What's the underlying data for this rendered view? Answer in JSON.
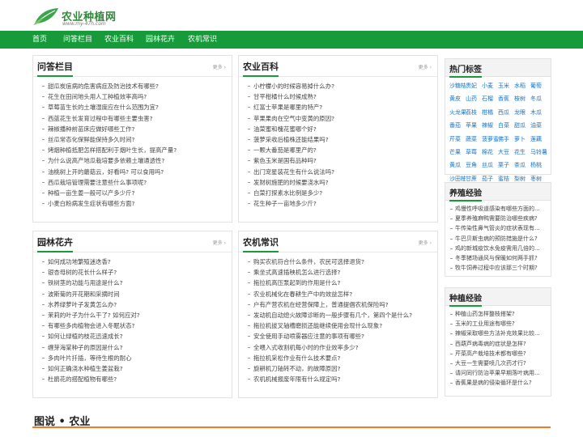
{
  "site": {
    "title": "农业种植网",
    "subtitle": "www.my-47h.com"
  },
  "nav": [
    "首页",
    "问答栏目",
    "农业百科",
    "园林花卉",
    "农机常识"
  ],
  "panels": {
    "qa": {
      "title": "问答栏目",
      "more": "更多",
      "items": [
        "甜瓜炭疽病的危害病症及防治技术有哪些?",
        "花生在田间地头用人工种植效率高吗?",
        "草莓苗生长的土壤湿度应在什么范围为宜?",
        "西蓝花生长发育过程中有哪些主要虫害?",
        "辣椒播种前苗床应做好哪些工作?",
        "丝瓜常态化保鲜能保持多久时间?",
        "烤烟种植抵肥怎样搭配利于烟叶生长，提高产量?",
        "为什么说高产地瓜栽培要多依赖土壤通透性?",
        "油桃树上开的蘑菇云，好看吗? 可以食用吗?",
        "西瓜栽培管理需要注意些什么事项呢?",
        "种植一亩生姜一般可以产多少斤?",
        "小麦白粉病发生症状有哪些方面?"
      ]
    },
    "encyclopedia": {
      "title": "农业百科",
      "more": "更多",
      "items": [
        "小柠檬小的时候容易掉什么办?",
        "甘平柑橘什么时候成熟?",
        "红富士苹果是哪里的特产?",
        "苹果果肉在空气中变黄的原因?",
        "油菜蜜和槐花蜜哪个好?",
        "菠萝采收后植株还能结果吗?",
        "一颗大番茄是哪里产的?",
        "紫色玉米是国有品种吗?",
        "出门宠星装花生有什么说法吗?",
        "发财树施肥的时候要浇水吗?",
        "白菜打探素水比例是多少?",
        "花生种子一亩地多少斤?"
      ]
    },
    "garden": {
      "title": "园林花卉",
      "more": "更多",
      "items": [
        "如何成功地繁殖迷迭香?",
        "银杏母树的花长什么样子?",
        "铁树茎的功能与用途是什么?",
        "波斯菊的开花期和采摘时间",
        "水养绿萝叶子发黄怎么办?",
        "茉莉的叶子为什么干了? 如何应对?",
        "有哪些多肉植物会进入冬眠状态?",
        "如何让绿植的枝花迅速成长?",
        "缠芽海棠种子的原因是什么?",
        "多肉叶片扦插，等待生根的耐心",
        "如何正确浇水种植生姜盆栽?",
        "杜鹃花的搭配植物有哪些?"
      ]
    },
    "machinery": {
      "title": "农机常识",
      "more": "更多",
      "items": [
        "购买农机符合什么条件，农民可选择退货?",
        "乘坐式高速插秧机怎么进行选择?",
        "拖拉机高压泵起到的作用是什么?",
        "农业机械化在春耕生产中的效益怎样?",
        "户有产营农机在经营保障上，普通提倡农机保险吗?",
        "发动机自动熄火故障诊断的一般步骤有几个，第四个是什么?",
        "拖拉机拔叉轴槽磨损还能继续使用会现什么现象?",
        "安全使用手动喷雾器应注意的事项有哪些?",
        "全喂入式收割机每小时的作业效率多少?",
        "拖拉机采松作业有什么技术要点?",
        "旋耕机刀轴转不动，的故障原因?",
        "农机机械报废年限有什么规定吗?"
      ]
    }
  },
  "sidebar": {
    "hot_tags": {
      "title": "热门标签",
      "tags": [
        "沙糖桔",
        "贵妃",
        "小麦",
        "玉米",
        "水稻",
        "葡萄",
        "黄皮",
        "山药",
        "石榴",
        "香蕉",
        "桉树",
        "冬瓜",
        "火龙果",
        "荔枝",
        "柑橘",
        "西瓜",
        "龙眼",
        "木瓜",
        "番茄",
        "苹果",
        "辣椒",
        "白菜",
        "甜瓜",
        "油菜",
        "芹菜",
        "蔬菜",
        "菠萝蜜",
        "佛手",
        "萝卜",
        "莲藕",
        "芒果",
        "草莓",
        "棉花",
        "大豆",
        "花生",
        "马铃薯",
        "黄瓜",
        "豆角",
        "丝瓜",
        "栗子",
        "茶瓜",
        "杨桃",
        "沙田柚",
        "甘蔗",
        "茄子",
        "蜜桔",
        "梨树",
        "枣树"
      ]
    },
    "breeding": {
      "title": "养殖经验",
      "items": [
        "鸡慢性呼吸道感染有哪些方面的...",
        "夏季养殖麻鸭需要防治哪些疾病?",
        "牛传染性鼻气管炎的症状表现有...",
        "牛巴贝斯虫病的预防措施是什么?",
        "鸡的新城疫饮水免疫需用几倍的...",
        "冬季猪场通风与保暖如何两手抓?",
        "牧牛饲养过程中应该那三个时期?"
      ]
    },
    "planting": {
      "title": "种植经验",
      "items": [
        "种植山药怎样整枝搭架?",
        "玉米的工业用途有哪些?",
        "辣椒采取哪些方法补充效果比较...",
        "西葫芦病毒病的症状是怎样?",
        "芹菜高产栽培技术都有哪些?",
        "大豆一生需要喷几次药才行?",
        "请问同行防治苹果早期落叶病用...",
        "香蕉果是病的侵染循环是什么?"
      ]
    }
  },
  "bottom": {
    "section_title": "图说 • 农业"
  }
}
